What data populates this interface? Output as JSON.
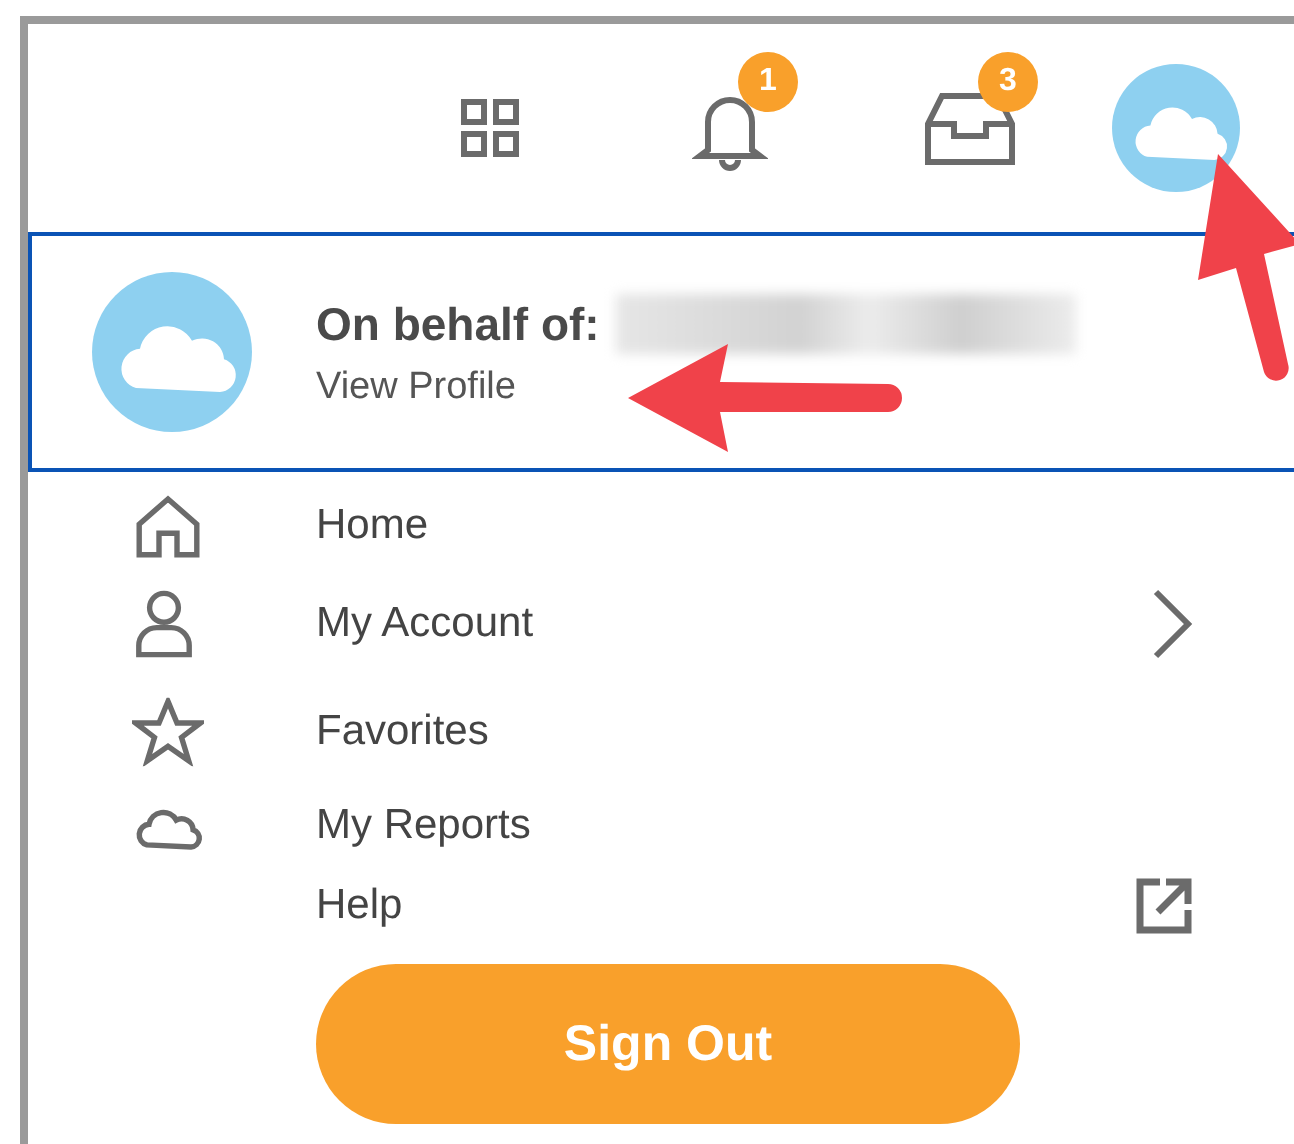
{
  "top_bar": {
    "icons": [
      {
        "kind": "apps"
      },
      {
        "kind": "bell",
        "badge": "1"
      },
      {
        "kind": "inbox",
        "badge": "3"
      },
      {
        "kind": "avatar"
      }
    ]
  },
  "profile": {
    "label": "On behalf of:",
    "link": "View Profile"
  },
  "menu": [
    {
      "label": "Home",
      "kind": "home",
      "has_submenu": false,
      "opens_external": false
    },
    {
      "label": "My Account",
      "kind": "person",
      "has_submenu": true,
      "opens_external": false
    },
    {
      "label": "Favorites",
      "kind": "star",
      "has_submenu": false,
      "opens_external": false
    },
    {
      "label": "My Reports",
      "kind": "cloud",
      "has_submenu": false,
      "opens_external": false
    },
    {
      "label": "Help",
      "kind": "plain",
      "has_submenu": false,
      "opens_external": true
    }
  ],
  "button": "Sign Out"
}
